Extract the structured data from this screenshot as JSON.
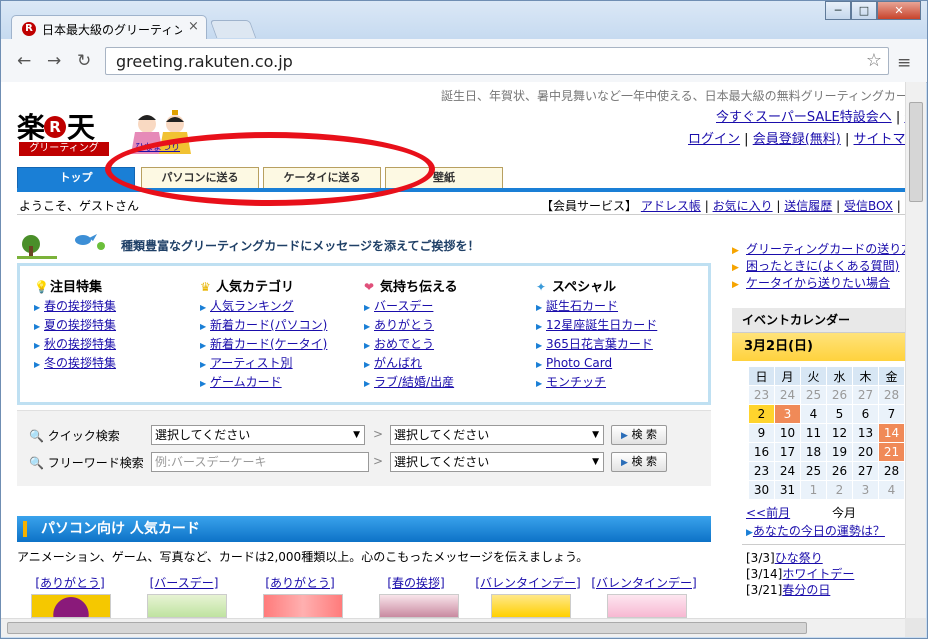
{
  "browser": {
    "tab_title": "日本最大級のグリーティン",
    "tab_favicon": "R",
    "tab_close": "×",
    "url": "greeting.rakuten.co.jp",
    "nav_back": "←",
    "nav_forward": "→",
    "nav_reload": "↻",
    "star": "☆",
    "menu": "≡",
    "win_min": "─",
    "win_max": "□",
    "win_close": "✕"
  },
  "header": {
    "tagline": "誕生日、年賀状、暑中見舞いなど一年中使える、日本最大級の無料グリーティングカー",
    "logo_left": "楽",
    "logo_mark": "R",
    "logo_right": "天",
    "logo_sub": "グリーティング",
    "dolls_link": "ひなまつり",
    "sale_link": "今すぐスーパーSALE特設会へ",
    "sale_link_cut": "楽",
    "login": "ログイン",
    "register": "会員登録(無料)",
    "sitemap": "サイトマッ",
    "sep": "|"
  },
  "tabs": [
    {
      "label": "トップ"
    },
    {
      "label": "パソコンに送る"
    },
    {
      "label": "ケータイに送る"
    },
    {
      "label": "壁紙"
    }
  ],
  "welcome": "ようこそ、ゲストさん",
  "member_services": {
    "label": "【会員サービス】",
    "links": [
      "アドレス帳",
      "お気に入り",
      "送信履歴",
      "受信BOX"
    ],
    "sep": "|"
  },
  "banner": "種類豊富なグリーティングカードにメッセージを添えてご挨拶を！",
  "categories": [
    {
      "title": "注目特集",
      "icon": "bulb-icon",
      "glyph": "💡",
      "items": [
        "春の挨拶特集",
        "夏の挨拶特集",
        "秋の挨拶特集",
        "冬の挨拶特集"
      ]
    },
    {
      "title": "人気カテゴリ",
      "icon": "crown-icon",
      "glyph": "♛",
      "items": [
        "人気ランキング",
        "新着カード(パソコン)",
        "新着カード(ケータイ)",
        "アーティスト別",
        "ゲームカード"
      ]
    },
    {
      "title": "気持ち伝える",
      "icon": "hearts-icon",
      "glyph": "❤",
      "items": [
        "バースデー",
        "ありがとう",
        "おめでとう",
        "がんばれ",
        "ラブ/結婚/出産"
      ]
    },
    {
      "title": "スペシャル",
      "icon": "party-icon",
      "glyph": "✦",
      "items": [
        "誕生石カード",
        "12星座誕生日カード",
        "365日花言葉カード",
        "Photo Card",
        "モンチッチ"
      ]
    }
  ],
  "search": {
    "quick_label": "クイック検索",
    "free_label": "フリーワード検索",
    "select_placeholder": "選択してください",
    "free_placeholder": "例:バースデーケーキ",
    "button": "検 索",
    "arrow": ">"
  },
  "pc_section": {
    "title": "パソコン向け 人気カード",
    "desc": "アニメーション、ゲーム、写真など、カードは2,000種類以上。心のこもったメッセージを伝えましょう。",
    "cards": [
      "[ありがとう]",
      "[バースデー]",
      "[ありがとう]",
      "[春の挨拶]",
      "[バレンタインデー]",
      "[バレンタインデー]"
    ]
  },
  "right_links": [
    "グリーティングカードの送り方",
    "困ったときに(よくある質問)",
    "ケータイから送りたい場合"
  ],
  "calendar": {
    "title": "イベントカレンダー",
    "date": "3月2日(日)",
    "weekdays": [
      "日",
      "月",
      "火",
      "水",
      "木",
      "金"
    ],
    "rows": [
      [
        "23",
        "24",
        "25",
        "26",
        "27",
        "28"
      ],
      [
        "2",
        "3",
        "4",
        "5",
        "6",
        "7"
      ],
      [
        "9",
        "10",
        "11",
        "12",
        "13",
        "14"
      ],
      [
        "16",
        "17",
        "18",
        "19",
        "20",
        "21"
      ],
      [
        "23",
        "24",
        "25",
        "26",
        "27",
        "28"
      ],
      [
        "30",
        "31",
        "1",
        "2",
        "3",
        "4"
      ]
    ],
    "prev": "<<前月",
    "current": "今月",
    "fortune": "あなたの今日の運勢は？",
    "events": [
      {
        "date": "[3/3]",
        "name": "ひな祭り"
      },
      {
        "date": "[3/14]",
        "name": "ホワイトデー"
      },
      {
        "date": "[3/21]",
        "name": "春分の日"
      }
    ]
  },
  "colors": {
    "accent": "#1a7fd6",
    "brand": "#bf0000",
    "annotation": "#e8101a"
  }
}
